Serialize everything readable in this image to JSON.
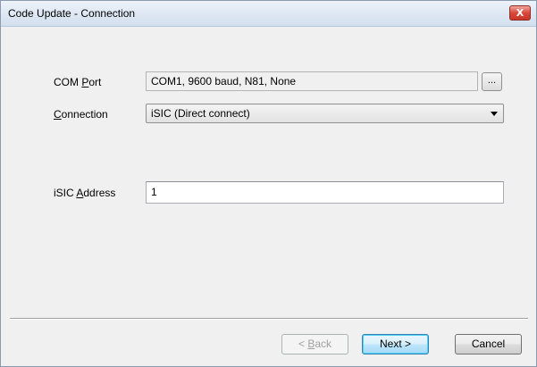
{
  "window": {
    "title": "Code Update - Connection",
    "close_label": "X"
  },
  "fields": {
    "com_port": {
      "label_underlined": "COM ",
      "label_hotkey": "P",
      "label_rest": "ort",
      "value": "COM1, 9600 baud, N81, None",
      "browse_label": "..."
    },
    "connection": {
      "label_hotkey": "C",
      "label_rest": "onnection",
      "selected": "iSIC (Direct connect)"
    },
    "isic_address": {
      "label_prefix": "iSIC ",
      "label_hotkey": "A",
      "label_rest": "ddress",
      "value": "1"
    }
  },
  "buttons": {
    "back_prefix": "< ",
    "back_hotkey": "B",
    "back_rest": "ack",
    "next": "Next >",
    "cancel": "Cancel"
  }
}
